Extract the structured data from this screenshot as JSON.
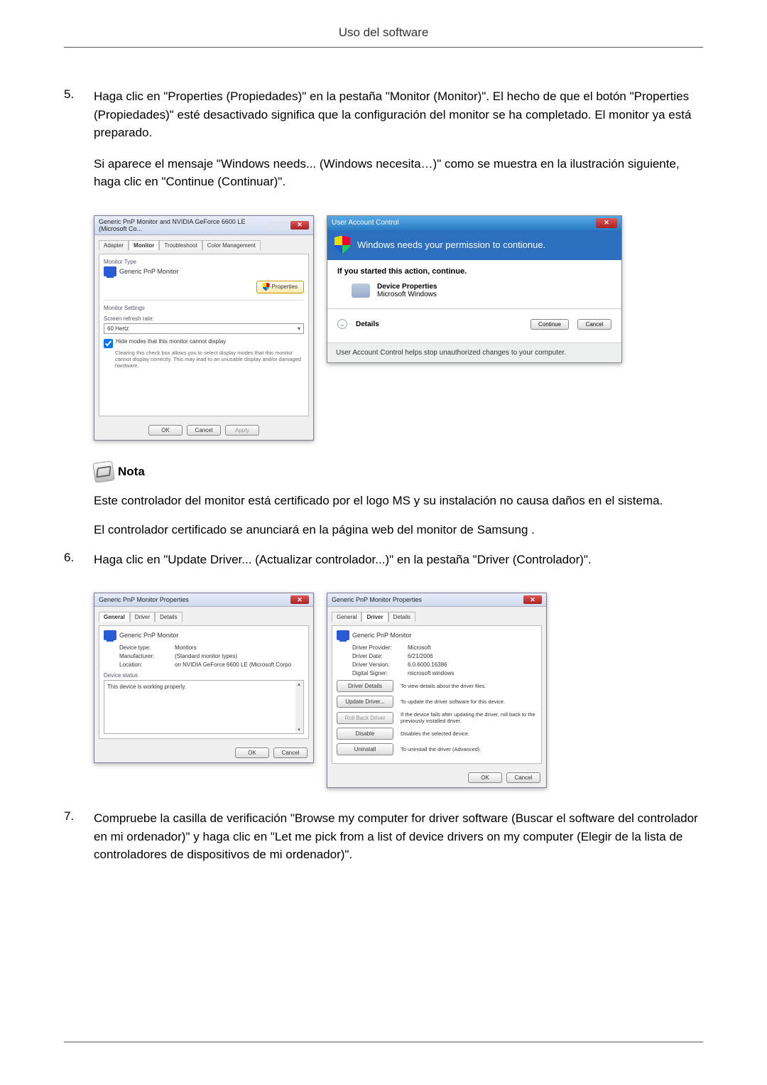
{
  "header": {
    "title": "Uso del software"
  },
  "steps": {
    "s5": {
      "num": "5.",
      "p1": "Haga clic en \"Properties (Propiedades)\" en la pestaña \"Monitor (Monitor)\". El hecho de que el botón \"Properties (Propiedades)\" esté desactivado significa que la configuración del monitor se ha completado. El monitor ya está preparado.",
      "p2": "Si aparece el mensaje \"Windows needs... (Windows necesita…)\" como se muestra en la ilustración siguiente, haga clic en \"Continue (Continuar)\"."
    },
    "s6": {
      "num": "6.",
      "p1": "Haga clic en \"Update Driver... (Actualizar controlador...)\" en la pestaña \"Driver (Controlador)\"."
    },
    "s7": {
      "num": "7.",
      "p1": "Compruebe la casilla de verificación \"Browse my computer for driver software (Buscar el software del controlador en mi ordenador)\" y haga clic en \"Let me pick from a list of device drivers on my computer (Elegir de la lista de controladores de dispositivos de mi ordenador)\"."
    }
  },
  "nota": {
    "label": "Nota",
    "p1": "Este controlador del monitor está certificado por el logo MS y su instalación no causa daños en el sistema.",
    "p2": "El controlador certificado se anunciará en la página web del monitor de Samsung ."
  },
  "dlg_monitor": {
    "title": "Generic PnP Monitor and NVIDIA GeForce 6600 LE (Microsoft Co...",
    "tabs": {
      "adapter": "Adapter",
      "monitor": "Monitor",
      "troubleshoot": "Troubleshoot",
      "colormgmt": "Color Management"
    },
    "mtype_label": "Monitor Type",
    "mtype_value": "Generic PnP Monitor",
    "properties_btn": "Properties",
    "settings_label": "Monitor Settings",
    "refresh_label": "Screen refresh rate:",
    "refresh_value": "60 Hertz",
    "hide_chk": "Hide modes that this monitor cannot display",
    "hide_desc": "Clearing this check box allows you to select display modes that this monitor cannot display correctly. This may lead to an unusable display and/or damaged hardware.",
    "ok": "OK",
    "cancel": "Cancel",
    "apply": "Apply"
  },
  "dlg_uac": {
    "title": "User Account Control",
    "banner": "Windows needs your permission to contionue.",
    "line": "If you started this action, continue.",
    "item_t": "Device Properties",
    "item_s": "Microsoft Windows",
    "details": "Details",
    "continue": "Continue",
    "cancel": "Cancel",
    "footer": "User Account Control helps stop unauthorized changes to your computer."
  },
  "dlg_props_general": {
    "title": "Generic PnP Monitor Properties",
    "tabs": {
      "general": "General",
      "driver": "Driver",
      "details": "Details"
    },
    "name": "Generic PnP Monitor",
    "rows": {
      "devtype_k": "Device type:",
      "devtype_v": "Monitors",
      "manu_k": "Manufacturer:",
      "manu_v": "(Standard monitor types)",
      "loc_k": "Location:",
      "loc_v": "on NVIDIA GeForce 6600 LE (Microsoft Corpo"
    },
    "ds_label": "Device status",
    "ds_text": "This device is working properly.",
    "ok": "OK",
    "cancel": "Cancel"
  },
  "dlg_props_driver": {
    "title": "Generic PnP Monitor Properties",
    "tabs": {
      "general": "General",
      "driver": "Driver",
      "details": "Details"
    },
    "name": "Generic PnP Monitor",
    "rows": {
      "prov_k": "Driver Provider:",
      "prov_v": "Microsoft",
      "date_k": "Driver Date:",
      "date_v": "6/21/2006",
      "ver_k": "Driver Version:",
      "ver_v": "6.0.6000.16386",
      "sign_k": "Digital Signer:",
      "sign_v": "microsoft windows"
    },
    "btns": {
      "details": "Driver Details",
      "details_d": "To view details about the driver files.",
      "update": "Update Driver...",
      "update_d": "To update the driver software for this device.",
      "rollback": "Roll Back Driver",
      "rollback_d": "If the device fails after updating the driver, roll back to the previously installed driver.",
      "disable": "Disable",
      "disable_d": "Disables the selected device.",
      "uninstall": "Uninstall",
      "uninstall_d": "To uninstall the driver (Advanced)."
    },
    "ok": "OK",
    "cancel": "Cancel"
  }
}
